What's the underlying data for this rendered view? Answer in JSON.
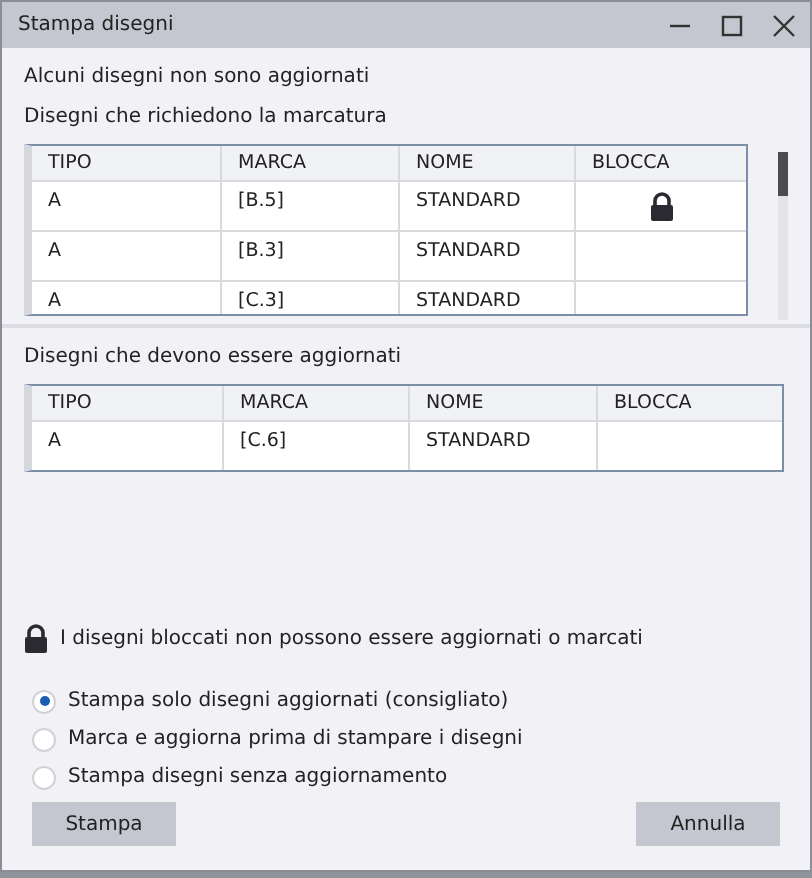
{
  "window": {
    "title": "Stampa disegni"
  },
  "message": "Alcuni disegni non sono aggiornati",
  "marking_section": {
    "title": "Disegni che richiedono la marcatura",
    "columns": [
      "TIPO",
      "MARCA",
      "NOME",
      "BLOCCA"
    ],
    "rows": [
      {
        "tipo": "A",
        "marca": "[B.5]",
        "nome": "STANDARD",
        "locked": true
      },
      {
        "tipo": "A",
        "marca": "[B.3]",
        "nome": "STANDARD",
        "locked": false
      },
      {
        "tipo": "A",
        "marca": "[C.3]",
        "nome": "STANDARD",
        "locked": false
      }
    ]
  },
  "update_section": {
    "title": "Disegni che devono essere aggiornati",
    "columns": [
      "TIPO",
      "MARCA",
      "NOME",
      "BLOCCA"
    ],
    "rows": [
      {
        "tipo": "A",
        "marca": "[C.6]",
        "nome": "STANDARD",
        "locked": false
      }
    ]
  },
  "lock_note": "I disegni bloccati non possono essere aggiornati o marcati",
  "options": [
    {
      "label": "Stampa solo disegni aggiornati (consigliato)",
      "selected": true
    },
    {
      "label": "Marca e aggiorna prima di stampare i disegni",
      "selected": false
    },
    {
      "label": "Stampa disegni senza aggiornamento",
      "selected": false
    }
  ],
  "buttons": {
    "primary": "Stampa",
    "cancel": "Annulla"
  }
}
